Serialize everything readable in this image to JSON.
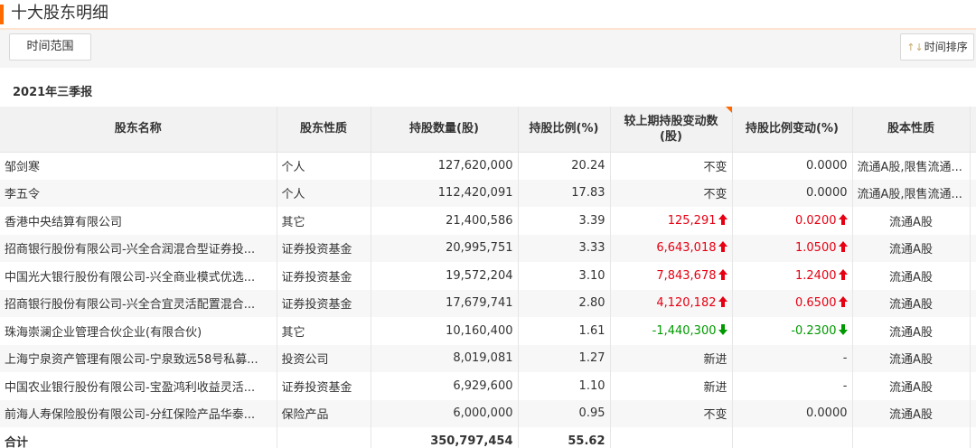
{
  "header": {
    "title": "十大股东明细"
  },
  "toolbar": {
    "range_label": "时间范围",
    "sort_icon": "↑↓",
    "sort_label": "时间排序"
  },
  "period": "2021年三季报",
  "table": {
    "columns": [
      "股东名称",
      "股东性质",
      "持股数量(股)",
      "持股比例(%)",
      "较上期持股变动数(股)",
      "持股比例变动(%)",
      "股本性质"
    ],
    "rows": [
      {
        "name": "邹剑寒",
        "type": "个人",
        "shares": "127,620,000",
        "ratio": "20.24",
        "change": "不变",
        "change_dir": "none",
        "ratio_change": "0.0000",
        "ratio_dir": "none",
        "nature": "流通A股,限售流通..."
      },
      {
        "name": "李五令",
        "type": "个人",
        "shares": "112,420,091",
        "ratio": "17.83",
        "change": "不变",
        "change_dir": "none",
        "ratio_change": "0.0000",
        "ratio_dir": "none",
        "nature": "流通A股,限售流通..."
      },
      {
        "name": "香港中央结算有限公司",
        "type": "其它",
        "shares": "21,400,586",
        "ratio": "3.39",
        "change": "125,291",
        "change_dir": "up",
        "ratio_change": "0.0200",
        "ratio_dir": "up",
        "nature": "流通A股"
      },
      {
        "name": "招商银行股份有限公司-兴全合润混合型证券投...",
        "type": "证券投资基金",
        "shares": "20,995,751",
        "ratio": "3.33",
        "change": "6,643,018",
        "change_dir": "up",
        "ratio_change": "1.0500",
        "ratio_dir": "up",
        "nature": "流通A股"
      },
      {
        "name": "中国光大银行股份有限公司-兴全商业模式优选...",
        "type": "证券投资基金",
        "shares": "19,572,204",
        "ratio": "3.10",
        "change": "7,843,678",
        "change_dir": "up",
        "ratio_change": "1.2400",
        "ratio_dir": "up",
        "nature": "流通A股"
      },
      {
        "name": "招商银行股份有限公司-兴全合宜灵活配置混合...",
        "type": "证券投资基金",
        "shares": "17,679,741",
        "ratio": "2.80",
        "change": "4,120,182",
        "change_dir": "up",
        "ratio_change": "0.6500",
        "ratio_dir": "up",
        "nature": "流通A股"
      },
      {
        "name": "珠海崇澜企业管理合伙企业(有限合伙)",
        "type": "其它",
        "shares": "10,160,400",
        "ratio": "1.61",
        "change": "-1,440,300",
        "change_dir": "down",
        "ratio_change": "-0.2300",
        "ratio_dir": "down",
        "nature": "流通A股"
      },
      {
        "name": "上海宁泉资产管理有限公司-宁泉致远58号私募...",
        "type": "投资公司",
        "shares": "8,019,081",
        "ratio": "1.27",
        "change": "新进",
        "change_dir": "none",
        "ratio_change": "-",
        "ratio_dir": "none",
        "nature": "流通A股"
      },
      {
        "name": "中国农业银行股份有限公司-宝盈鸿利收益灵活...",
        "type": "证券投资基金",
        "shares": "6,929,600",
        "ratio": "1.10",
        "change": "新进",
        "change_dir": "none",
        "ratio_change": "-",
        "ratio_dir": "none",
        "nature": "流通A股"
      },
      {
        "name": "前海人寿保险股份有限公司-分红保险产品华泰...",
        "type": "保险产品",
        "shares": "6,000,000",
        "ratio": "0.95",
        "change": "不变",
        "change_dir": "none",
        "ratio_change": "0.0000",
        "ratio_dir": "none",
        "nature": "流通A股"
      }
    ],
    "total": {
      "label": "合计",
      "shares": "350,797,454",
      "ratio": "55.62"
    }
  },
  "colors": {
    "accent": "#ff6a00",
    "up": "#e60012",
    "down": "#009900"
  }
}
